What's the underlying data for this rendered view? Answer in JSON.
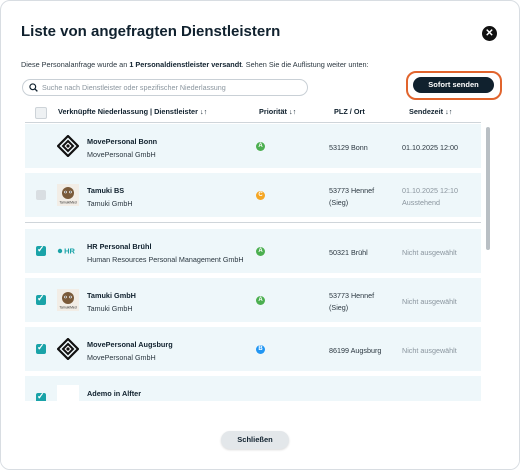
{
  "dialog": {
    "title": "Liste von angefragten Dienstleistern",
    "close_icon": "close-icon",
    "info_prefix": "Diese Personalanfrage wurde an ",
    "info_bold": "1 Personaldienstleister versandt",
    "info_suffix": ". Sehen Sie die Auflistung weiter unten:",
    "search_placeholder": "Suche nach Dienstleister oder spezifischer Niederlassung",
    "send_button": "Sofort senden",
    "close_button": "Schließen",
    "accent_color": "#1aa3a8",
    "highlight_color": "#e1642d"
  },
  "table": {
    "headers": {
      "branch": "Verknüpfte Niederlassung | Dienstleister ↓↑",
      "priority": "Priorität ↓↑",
      "plz": "PLZ / Ort",
      "sendtime": "Sendezeit ↓↑"
    },
    "rows": [
      {
        "checkbox": "none",
        "logo": "movepersonal-logo",
        "name": "MovePersonal Bonn",
        "company": "MovePersonal GmbH",
        "priority": "A",
        "priority_color": "#4caf50",
        "plz_line1": "53129 Bonn",
        "plz_line2": "",
        "time_line1": "01.10.2025 12:00",
        "time_line2": "",
        "time_muted": false
      },
      {
        "checkbox": "disabled",
        "logo": "tamuki-logo",
        "name": "Tamuki BS",
        "company": "Tamuki GmbH",
        "priority": "C",
        "priority_color": "#f5a623",
        "plz_line1": "53773 Hennef",
        "plz_line2": "(Sieg)",
        "time_line1": "01.10.2025 12:10",
        "time_line2": "Ausstehend",
        "time_muted": true
      },
      {
        "checkbox": "checked",
        "logo": "hr-logo",
        "name": "HR Personal Brühl",
        "company": "Human Resources Personal Management GmbH",
        "priority": "A",
        "priority_color": "#4caf50",
        "plz_line1": "50321 Brühl",
        "plz_line2": "",
        "time_line1": "Nicht ausgewählt",
        "time_line2": "",
        "time_muted": true
      },
      {
        "checkbox": "checked",
        "logo": "tamuki-logo",
        "name": "Tamuki GmbH",
        "company": "Tamuki GmbH",
        "priority": "A",
        "priority_color": "#4caf50",
        "plz_line1": "53773 Hennef",
        "plz_line2": "(Sieg)",
        "time_line1": "Nicht ausgewählt",
        "time_line2": "",
        "time_muted": true
      },
      {
        "checkbox": "checked",
        "logo": "movepersonal-logo",
        "name": "MovePersonal Augsburg",
        "company": "MovePersonal GmbH",
        "priority": "B",
        "priority_color": "#2196f3",
        "plz_line1": "86199 Augsburg",
        "plz_line2": "",
        "time_line1": "Nicht ausgewählt",
        "time_line2": "",
        "time_muted": true
      },
      {
        "checkbox": "checked",
        "logo": "ademo-logo",
        "name": "Ademo in Alfter",
        "company": "",
        "priority": "",
        "priority_color": "#4caf50",
        "plz_line1": "",
        "plz_line2": "",
        "time_line1": "",
        "time_line2": "",
        "time_muted": true
      }
    ]
  },
  "logos": {
    "hr_text": "HR",
    "tamuki_text": "TamukiMed"
  }
}
